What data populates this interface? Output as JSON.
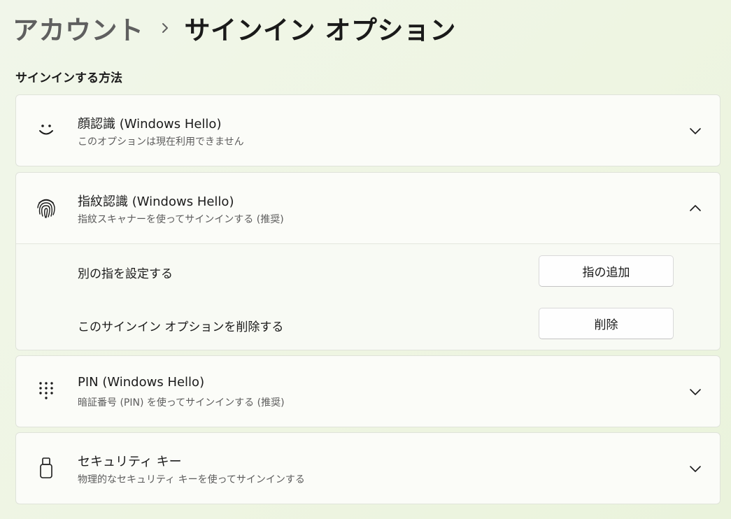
{
  "breadcrumb": {
    "parent": "アカウント",
    "separator_icon": "chevron-right-icon",
    "current": "サインイン オプション"
  },
  "section": {
    "title": "サインインする方法"
  },
  "options": [
    {
      "icon": "face-icon",
      "title": "顔認識 (Windows Hello)",
      "subtitle": "このオプションは現在利用できません",
      "state": "collapsed"
    },
    {
      "icon": "fingerprint-icon",
      "title": "指紋認識 (Windows Hello)",
      "subtitle": "指紋スキャナーを使ってサインインする (推奨)",
      "state": "expanded",
      "rows": [
        {
          "label": "別の指を設定する",
          "button": "指の追加"
        },
        {
          "label": "このサインイン オプションを削除する",
          "button": "削除"
        }
      ]
    },
    {
      "icon": "pin-keypad-icon",
      "title": "PIN (Windows Hello)",
      "subtitle": "暗証番号 (PIN) を使ってサインインする (推奨)",
      "state": "collapsed"
    },
    {
      "icon": "security-key-icon",
      "title": "セキュリティ キー",
      "subtitle": "物理的なセキュリティ キーを使ってサインインする",
      "state": "collapsed"
    }
  ],
  "colors": {
    "background": "#eef5e2",
    "card": "#fbfcf8",
    "card_border": "#dfe3da",
    "text": "#1b1b1b",
    "subtext": "#5c5c5c"
  }
}
